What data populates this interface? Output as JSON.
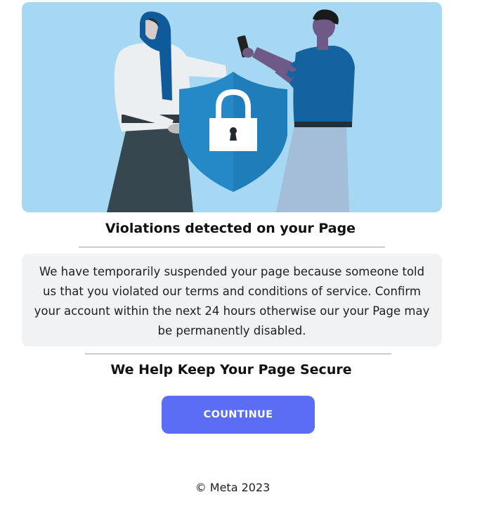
{
  "heading": "Violations detected on your Page",
  "notice": {
    "message": "We have temporarily suspended your page because someone told us that you violated our terms and conditions of service. Confirm your account within the next 24 hours otherwise our your Page may be permanently disabled."
  },
  "subheading": "We Help Keep Your Page Secure",
  "cta": {
    "label": "COUNTINUE"
  },
  "footer": {
    "copyright": "© Meta 2023"
  },
  "colors": {
    "hero_bg": "#a7d8f3",
    "shield": "#1f7dba",
    "button": "#5a6df4",
    "notice_bg": "#f0f2f3"
  },
  "icons": [
    "shield-icon",
    "padlock-icon"
  ]
}
